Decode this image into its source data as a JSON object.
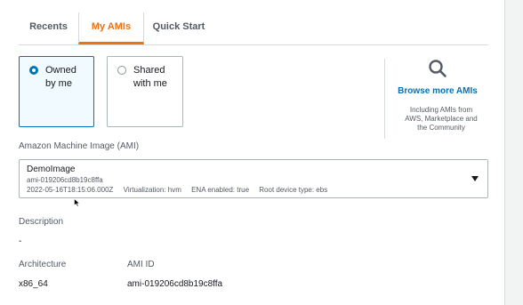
{
  "tabs": [
    {
      "label": "Recents"
    },
    {
      "label": "My AMIs"
    },
    {
      "label": "Quick Start"
    }
  ],
  "source_options": {
    "owned": {
      "label_line1": "Owned",
      "label_line2": "by me",
      "selected": true
    },
    "shared": {
      "label_line1": "Shared",
      "label_line2": "with me",
      "selected": false
    }
  },
  "browse": {
    "icon": "search-icon",
    "link": "Browse more AMIs",
    "sub_line1": "Including AMIs from",
    "sub_line2": "AWS, Marketplace and",
    "sub_line3": "the Community"
  },
  "ami": {
    "label": "Amazon Machine Image (AMI)",
    "name": "DemoImage",
    "id": "ami-019206cd8b19c8ffa",
    "created": "2022-05-16T18:15:06.000Z",
    "virtualization": "Virtualization: hvm",
    "ena": "ENA enabled: true",
    "root_device": "Root device type: ebs"
  },
  "details": {
    "description_label": "Description",
    "description_value": "-",
    "architecture_label": "Architecture",
    "architecture_value": "x86_64",
    "ami_id_label": "AMI ID",
    "ami_id_value": "ami-019206cd8b19c8ffa"
  },
  "colors": {
    "accent": "#ec7211",
    "link": "#0073bb"
  }
}
